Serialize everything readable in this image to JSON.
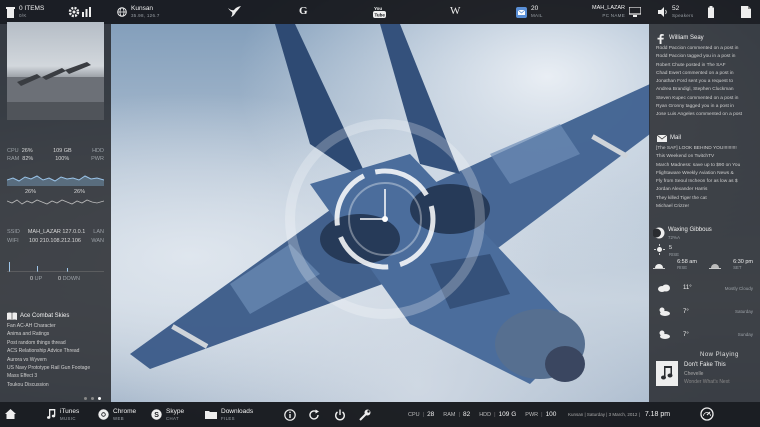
{
  "topbar": {
    "items_count": "0 ITEMS",
    "items_size": "0/K",
    "location": "Kunsan",
    "location_sub": "35.98, 126.7",
    "mail_count": "20",
    "mail_label": "MAIL",
    "pc_name": "MAH_LAZAR",
    "pc_sub": "PC NAME",
    "volume": "52",
    "volume_label": "Speakers",
    "google_letter": "G",
    "wiki_letter": "W"
  },
  "left": {
    "cpu_label": "CPU",
    "cpu_value": "26%",
    "mem_value": "109 GB",
    "hdd_label": "HDD",
    "ram_label": "RAM",
    "ram_value": "82%",
    "hdd_pct": "100%",
    "pwr_label": "PWR",
    "graph_left": "26%",
    "graph_right": "26%",
    "ssid_label": "SSID",
    "ssid_value": "MAH_LAZAR 127.0.0.1",
    "lan_label": "LAN",
    "wifi_label": "WIFI",
    "wifi_value": "100  210.108.212.106",
    "wan_label": "WAN",
    "net_up": "0",
    "net_up_label": "UP",
    "net_down": "0",
    "net_down_label": "DOWN",
    "feed_title": "Ace Combat Skies",
    "feed": [
      "Fan AC-AH Character",
      "Anima and Ratings",
      "Post random things thread",
      "ACS Relationship Advice Thread",
      "Aurora vs Wyvern",
      "US Navy Prototype Rail Gun Footage",
      "Mass Effect 3",
      "Toukou Discussion"
    ]
  },
  "right": {
    "fb_name": "William Seay",
    "fb_items": [
      "Rodd Paccion commented on a post in",
      "Rodd Paccion tagged you in a post in",
      "Robert Chute posted in The SAF",
      "Chad Ewert commented on a post in",
      "Jonathan Ford sent you a request to",
      "Andrea Brandigl, Stephen Cluckman",
      "Steven Kupec commented on a post in",
      "Ryan Gronny tagged you in a post in",
      "Jose Luis Angeles commented on a post"
    ],
    "mail_title": "Mail",
    "mail_items": [
      "[The SAF] LOOK BEHIND YOU!!!!!!!!!!",
      "This Weekend on TwitchTV",
      "March Madness: save up to $90 on You",
      "Flightaware Weekly Aviation News &",
      "Fly from Seoul Incheon for as low as $",
      "Jordan Alexander Harris",
      "They killed Tiger the cat",
      "Michael Crizzer"
    ],
    "moon_phase": "Waxing Gibbous",
    "moon_sub": "72%A",
    "rise_label": "5",
    "rise_sub": "RISE",
    "sunrise": "6:58 am",
    "sunrise_label": "RISE",
    "sunset": "6:30 pm",
    "sunset_label": "SET",
    "weather": [
      {
        "temp": "11°",
        "desc": "Mostly Cloudy"
      },
      {
        "temp": "7°",
        "desc": "Saturday"
      },
      {
        "temp": "7°",
        "desc": "Sunday"
      }
    ],
    "now_playing_label": "Now Playing",
    "track": "Don't Fake This",
    "artist": "Chevelle",
    "album": "Wonder What's Next"
  },
  "bottom": {
    "itunes": "iTunes",
    "itunes_sub": "MUSIC",
    "chrome": "Chrome",
    "chrome_sub": "WEB",
    "skype": "Skype",
    "skype_sub": "CHAT",
    "downloads": "Downloads",
    "downloads_sub": "FILES",
    "cpu_label": "CPU",
    "cpu": "28",
    "ram_label": "RAM",
    "ram": "82",
    "hdd_label": "HDD",
    "hdd": "109 G",
    "pwr_label": "PWR",
    "pwr": "100",
    "date": "Kunsan | Saturday | 3 March, 2012 |",
    "time": "7.18 pm"
  },
  "colors": {
    "panel": "#2a2c30",
    "bar": "#121418",
    "text": "#e8e8e8",
    "accent": "#ffffff"
  }
}
